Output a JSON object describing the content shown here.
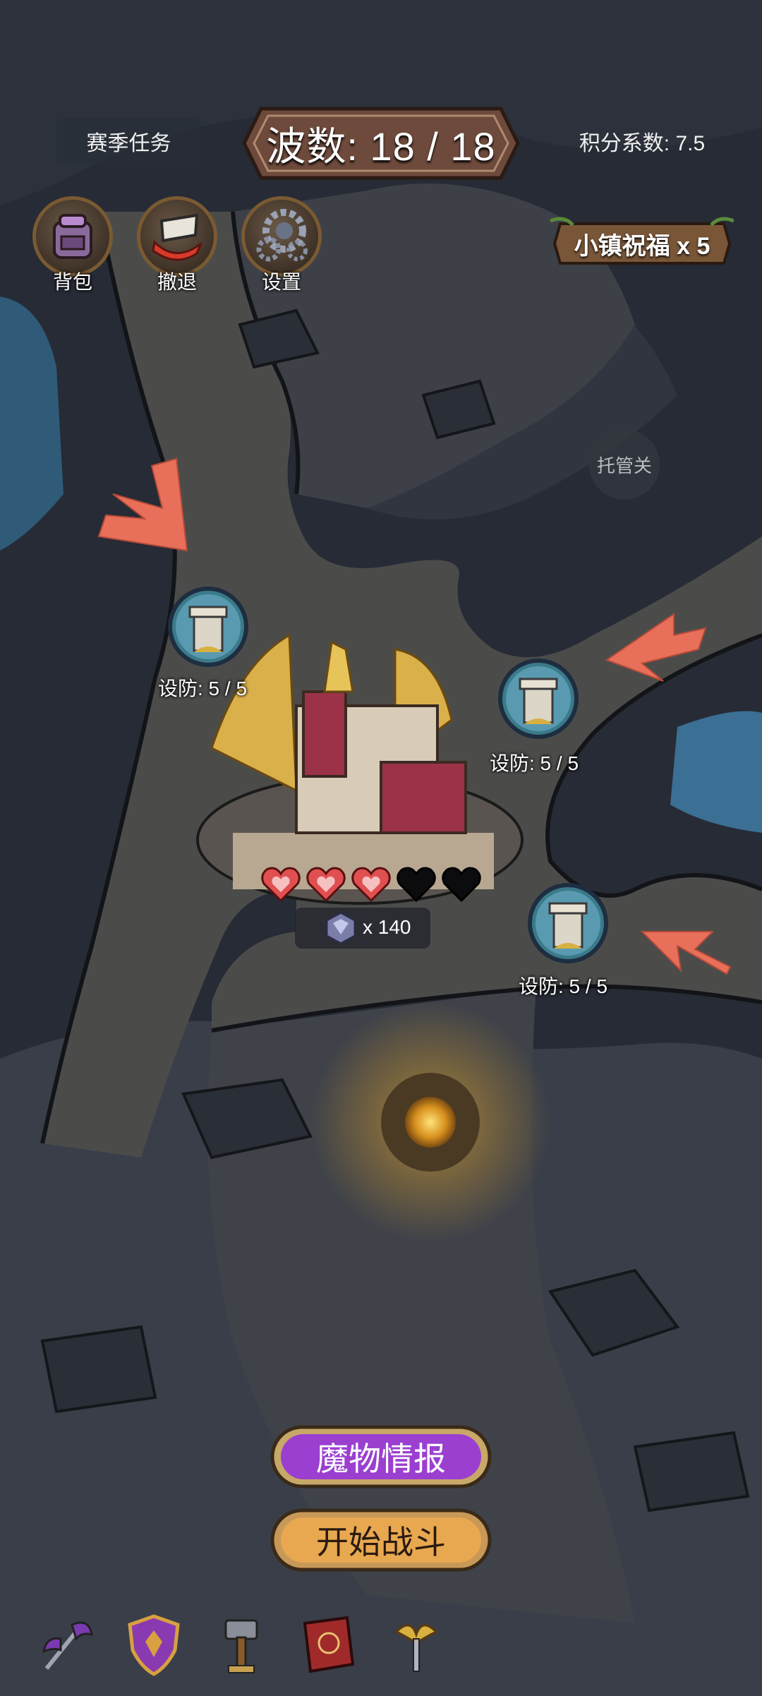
{
  "header": {
    "season_tasks": "赛季任务",
    "wave_label": "波数: 18 / 18",
    "score_factor": "积分系数: 7.5"
  },
  "top_buttons": [
    {
      "label": "背包",
      "icon": "backpack-icon"
    },
    {
      "label": "撤退",
      "icon": "retreat-flag-icon"
    },
    {
      "label": "设置",
      "icon": "gears-icon"
    }
  ],
  "blessing": "小镇祝福 x 5",
  "auto_toggle": "托管关",
  "towers": [
    {
      "label": "设防: 5 / 5"
    },
    {
      "label": "设防: 5 / 5"
    },
    {
      "label": "设防: 5 / 5"
    }
  ],
  "base": {
    "hearts_total": 5,
    "hearts_filled": 3,
    "gem_count": "x 140"
  },
  "actions": {
    "monster_info": "魔物情报",
    "start_battle": "开始战斗"
  },
  "toolbar": [
    "battle-axe-icon",
    "shield-icon",
    "hammer-icon",
    "spellbook-icon",
    "winged-sword-icon"
  ],
  "colors": {
    "heart": "#e05050",
    "arrow": "#e8705a",
    "purple_button": "#9b3fd0",
    "orange_button": "#e8a850",
    "plate": "#6e4a3c"
  }
}
